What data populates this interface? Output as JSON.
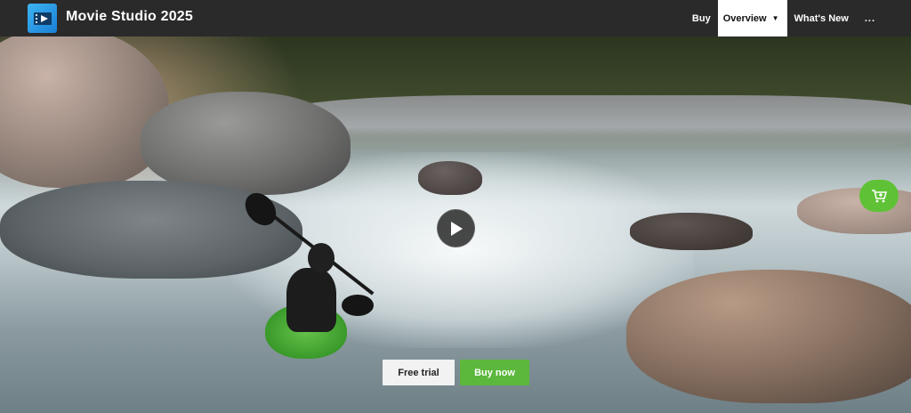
{
  "header": {
    "app_title": "Movie Studio 2025",
    "logo_icon": "film-play-icon",
    "nav": [
      {
        "label": "Buy"
      },
      {
        "label": "Overview",
        "active": true
      },
      {
        "label": "What's New"
      },
      {
        "label": "..."
      }
    ]
  },
  "hero": {
    "play_icon": "play-icon",
    "cart_icon": "cart-icon",
    "buttons": {
      "free_trial": "Free trial",
      "buy_now": "Buy now"
    }
  },
  "colors": {
    "topbar": "#2a2a2a",
    "accent_green": "#5cb83c",
    "logo_blue": "#1b7fd6"
  }
}
